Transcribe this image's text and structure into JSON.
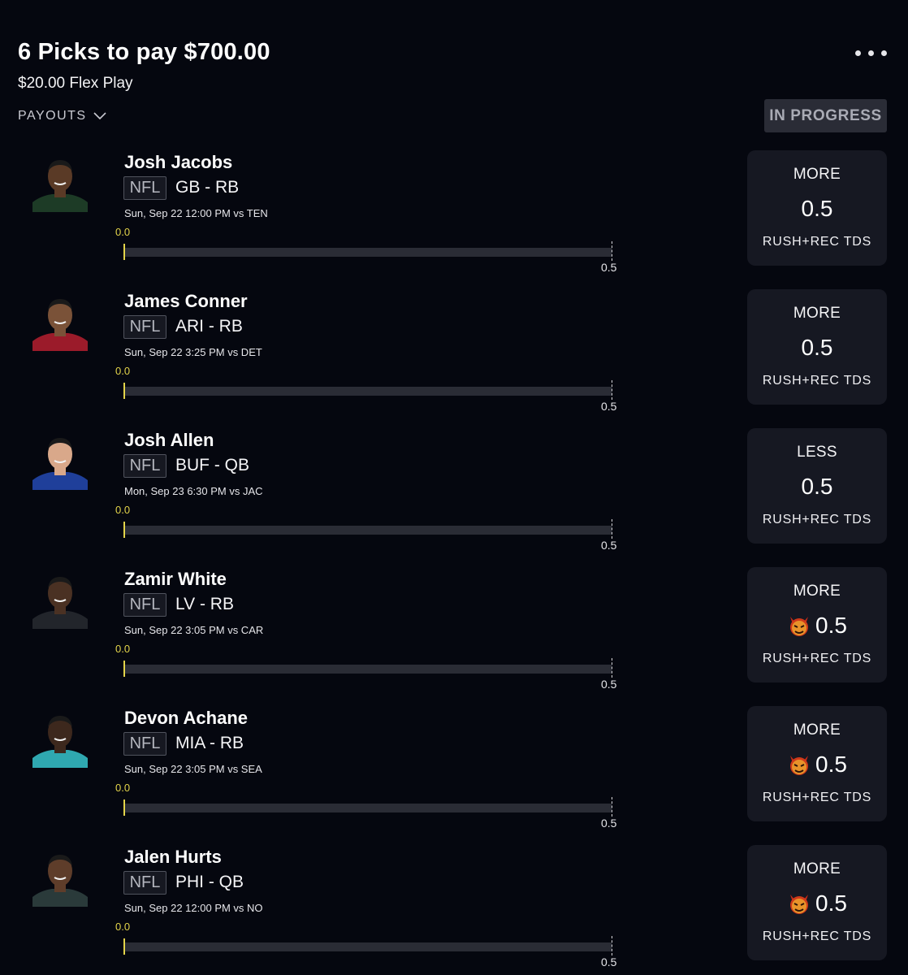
{
  "header": {
    "title": "6 Picks to pay $700.00",
    "subtitle": "$20.00 Flex Play",
    "payouts_label": "PAYOUTS",
    "status": "IN PROGRESS"
  },
  "colors": {
    "background": "#05070f",
    "card": "#161822",
    "progress_accent": "#e3d44a",
    "badge_bg": "#2a2c36"
  },
  "picks": [
    {
      "name": "Josh Jacobs",
      "league": "NFL",
      "team_pos": "GB - RB",
      "game": "Sun, Sep 22 12:00 PM  vs TEN",
      "current": "0.0",
      "target": "0.5",
      "progress_fraction": 0,
      "direction": "MORE",
      "line": "0.5",
      "stat": "RUSH+REC TDS",
      "boosted": false,
      "jersey_color": "#1d3b26",
      "skin_color": "#5a3a26"
    },
    {
      "name": "James Conner",
      "league": "NFL",
      "team_pos": "ARI - RB",
      "game": "Sun, Sep 22 3:25 PM  vs DET",
      "current": "0.0",
      "target": "0.5",
      "progress_fraction": 0,
      "direction": "MORE",
      "line": "0.5",
      "stat": "RUSH+REC TDS",
      "boosted": false,
      "jersey_color": "#9b1b2a",
      "skin_color": "#7a5238"
    },
    {
      "name": "Josh Allen",
      "league": "NFL",
      "team_pos": "BUF - QB",
      "game": "Mon, Sep 23 6:30 PM  vs JAC",
      "current": "0.0",
      "target": "0.5",
      "progress_fraction": 0,
      "direction": "LESS",
      "line": "0.5",
      "stat": "RUSH+REC TDS",
      "boosted": false,
      "jersey_color": "#1f3f9a",
      "skin_color": "#d9a88a"
    },
    {
      "name": "Zamir White",
      "league": "NFL",
      "team_pos": "LV - RB",
      "game": "Sun, Sep 22 3:05 PM  vs CAR",
      "current": "0.0",
      "target": "0.5",
      "progress_fraction": 0,
      "direction": "MORE",
      "line": "0.5",
      "stat": "RUSH+REC TDS",
      "boosted": true,
      "jersey_color": "#22252b",
      "skin_color": "#4a3123"
    },
    {
      "name": "Devon Achane",
      "league": "NFL",
      "team_pos": "MIA - RB",
      "game": "Sun, Sep 22 3:05 PM  vs SEA",
      "current": "0.0",
      "target": "0.5",
      "progress_fraction": 0,
      "direction": "MORE",
      "line": "0.5",
      "stat": "RUSH+REC TDS",
      "boosted": true,
      "jersey_color": "#2fa8b0",
      "skin_color": "#3d281d"
    },
    {
      "name": "Jalen Hurts",
      "league": "NFL",
      "team_pos": "PHI - QB",
      "game": "Sun, Sep 22 12:00 PM  vs NO",
      "current": "0.0",
      "target": "0.5",
      "progress_fraction": 0,
      "direction": "MORE",
      "line": "0.5",
      "stat": "RUSH+REC TDS",
      "boosted": true,
      "jersey_color": "#2a3a3a",
      "skin_color": "#5e3d2a"
    }
  ]
}
